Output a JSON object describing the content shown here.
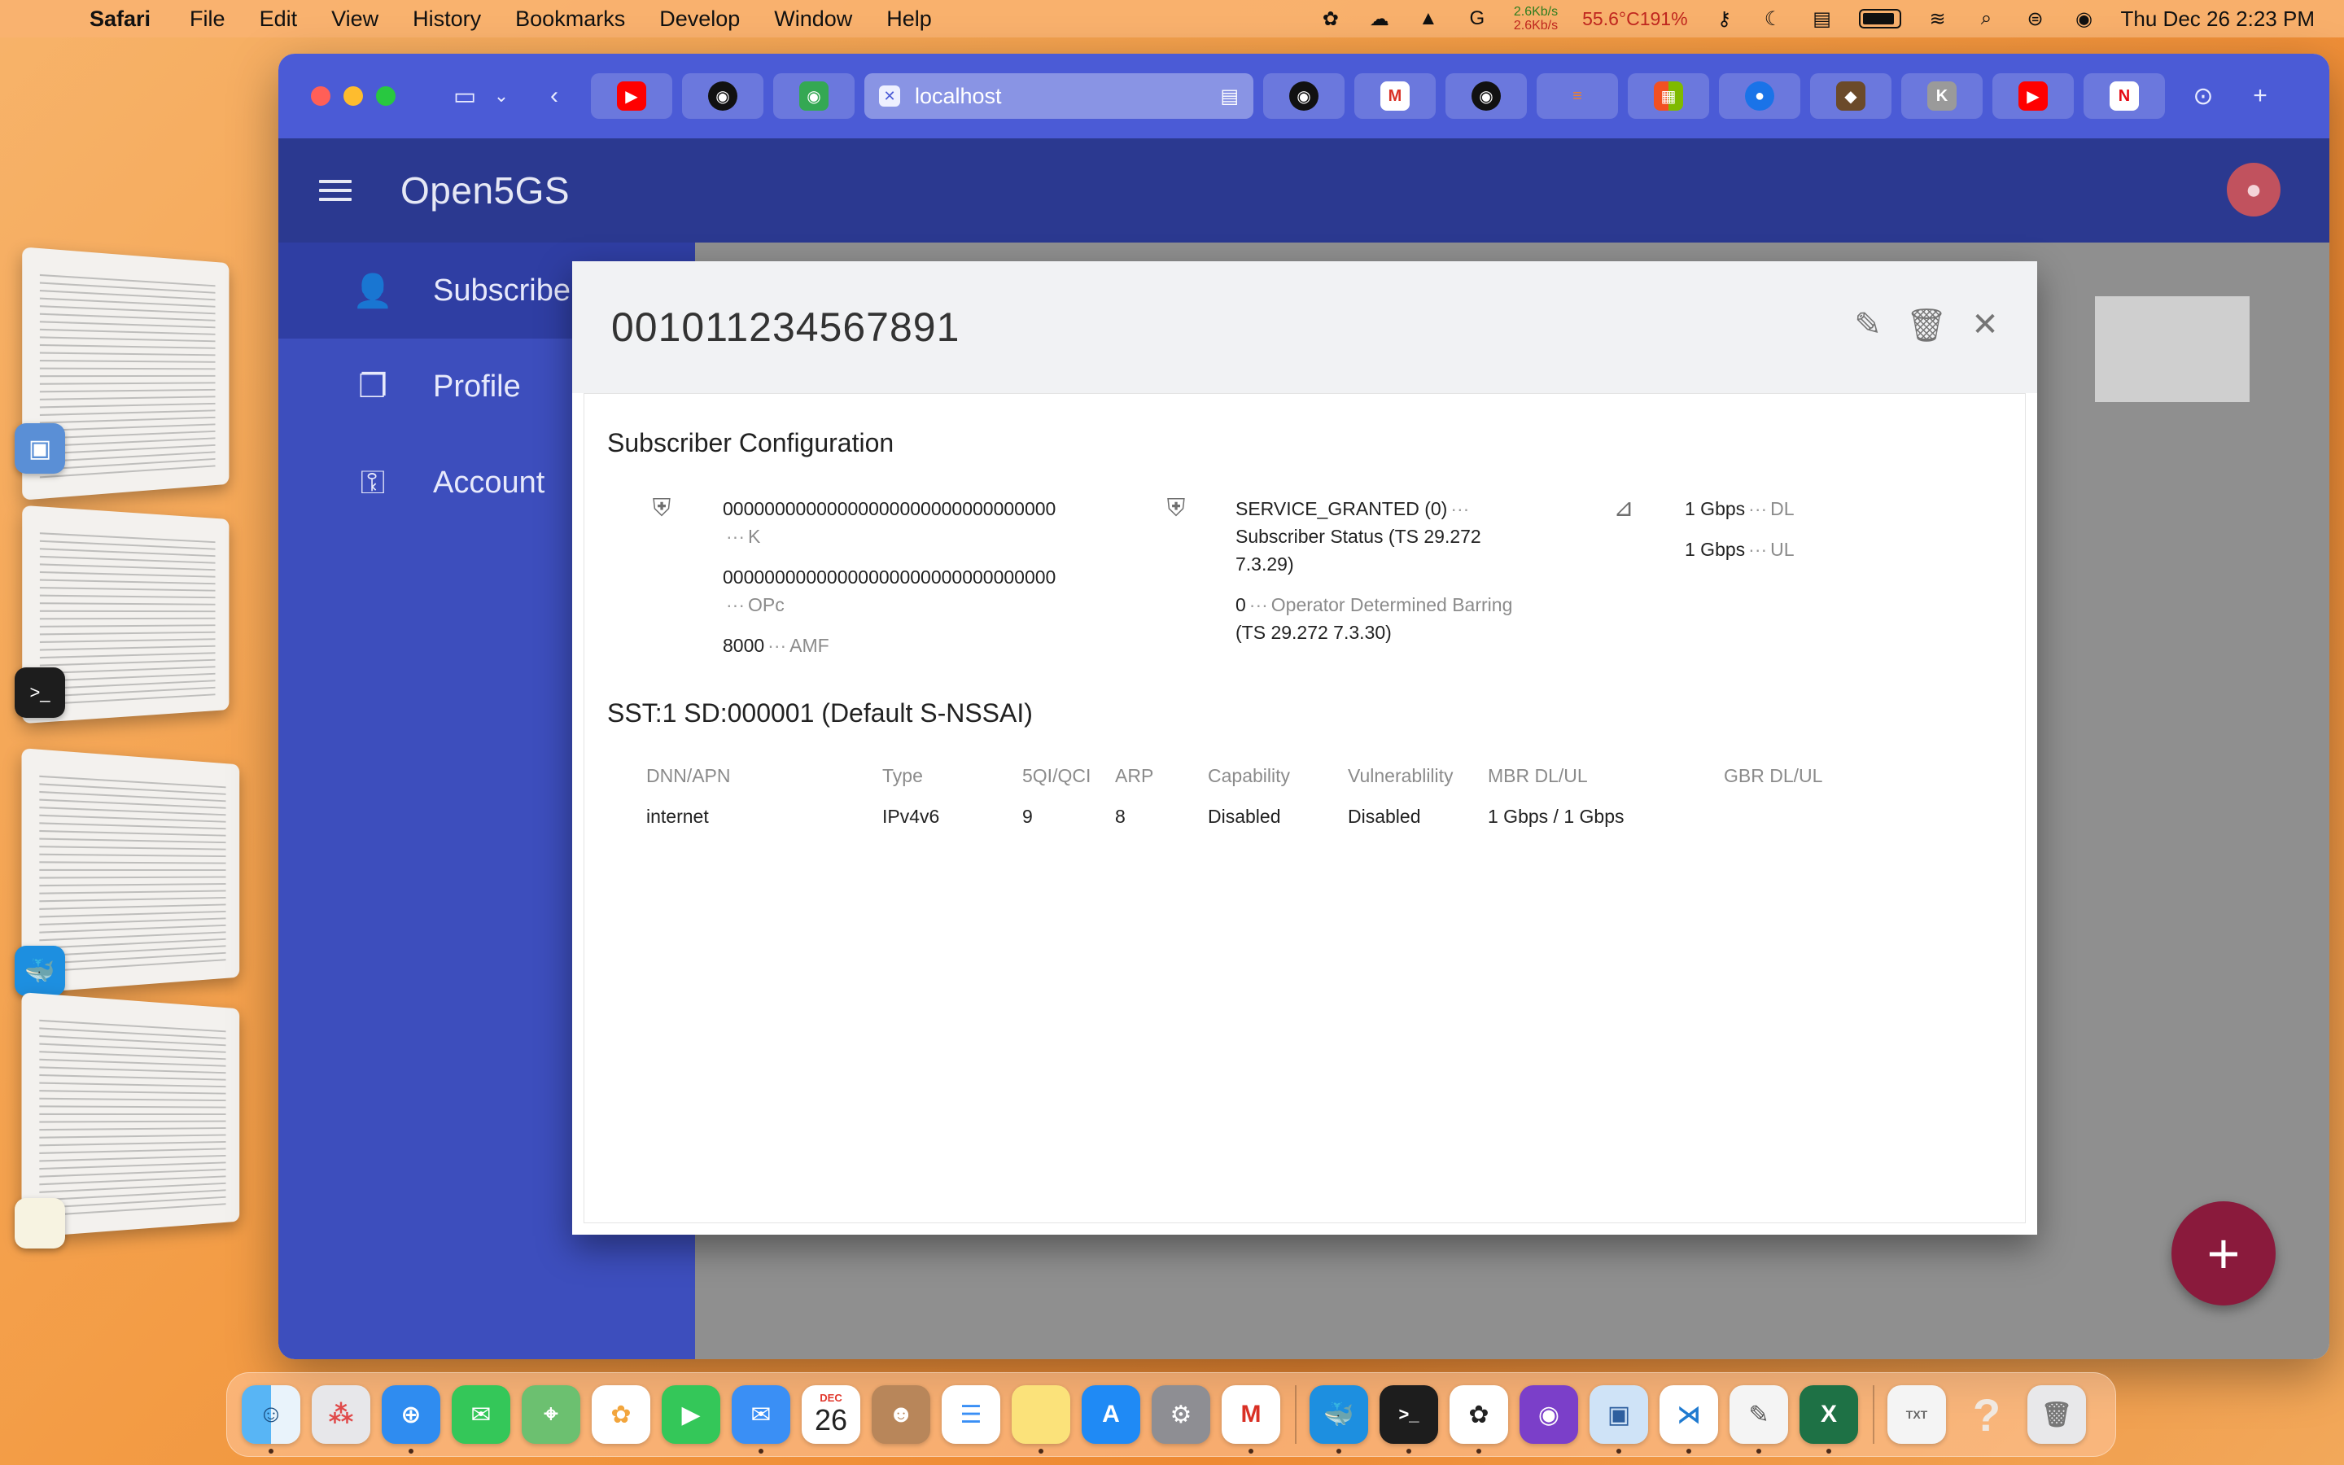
{
  "menubar": {
    "app_name": "Safari",
    "menus": [
      "File",
      "Edit",
      "View",
      "History",
      "Bookmarks",
      "Develop",
      "Window",
      "Help"
    ],
    "net_up": "2.6Kb/s",
    "net_down": "2.6Kb/s",
    "temp": "55.6°C191%",
    "clock": "Thu Dec 26  2:23 PM"
  },
  "browser": {
    "address": "localhost",
    "tabs_left": [
      "youtube",
      "github",
      "github-green"
    ],
    "tabs_right": [
      "github",
      "gmail",
      "github",
      "stackoverflow",
      "microsoft",
      "chrome",
      "fox",
      "K",
      "youtube",
      "netflix"
    ]
  },
  "app": {
    "title": "Open5GS",
    "nav": [
      {
        "label": "Subscriber",
        "icon": "person-add-icon"
      },
      {
        "label": "Profile",
        "icon": "copy-icon"
      },
      {
        "label": "Account",
        "icon": "key-icon"
      }
    ]
  },
  "modal": {
    "title": "001011234567891",
    "section_config": "Subscriber Configuration",
    "security": {
      "k_value": "00000000000000000000000000000000",
      "k_label": "K",
      "opc_value": "00000000000000000000000000000000",
      "opc_label": "OPc",
      "amf_value": "8000",
      "amf_label": "AMF"
    },
    "status": {
      "subscriber_status_value": "SERVICE_GRANTED (0)",
      "subscriber_status_label_1": "Subscriber Status (TS 29.272",
      "subscriber_status_label_2": "7.3.29)",
      "odb_value": "0",
      "odb_label_1": "Operator Determined Barring",
      "odb_label_2": "(TS 29.272 7.3.30)"
    },
    "ambr": {
      "dl_value": "1 Gbps",
      "dl_label": "DL",
      "ul_value": "1 Gbps",
      "ul_label": "UL"
    },
    "slice_title": "SST:1 SD:000001 (Default S-NSSAI)",
    "session_table": {
      "headers": [
        "DNN/APN",
        "Type",
        "5QI/QCI",
        "ARP",
        "Capability",
        "Vulnerablility",
        "MBR DL/UL",
        "GBR DL/UL"
      ],
      "rows": [
        [
          "internet",
          "IPv4v6",
          "9",
          "8",
          "Disabled",
          "Disabled",
          "1 Gbps / 1 Gbps",
          ""
        ]
      ]
    }
  },
  "fab_label": "+",
  "dock": [
    "Finder",
    "Launchpad",
    "Safari",
    "Messages",
    "Maps",
    "Photos",
    "FaceTime",
    "Mail",
    "Calendar",
    "Contacts",
    "Reminders",
    "Notes",
    "App Store",
    "System Settings",
    "Gmail",
    "Docker",
    "Terminal",
    "ChatGPT",
    "GitHub Desktop",
    "Preview",
    "VS Code",
    "TextEdit",
    "Excel",
    "Document",
    "Help",
    "Trash"
  ],
  "calendar": {
    "month": "DEC",
    "day": "26"
  }
}
